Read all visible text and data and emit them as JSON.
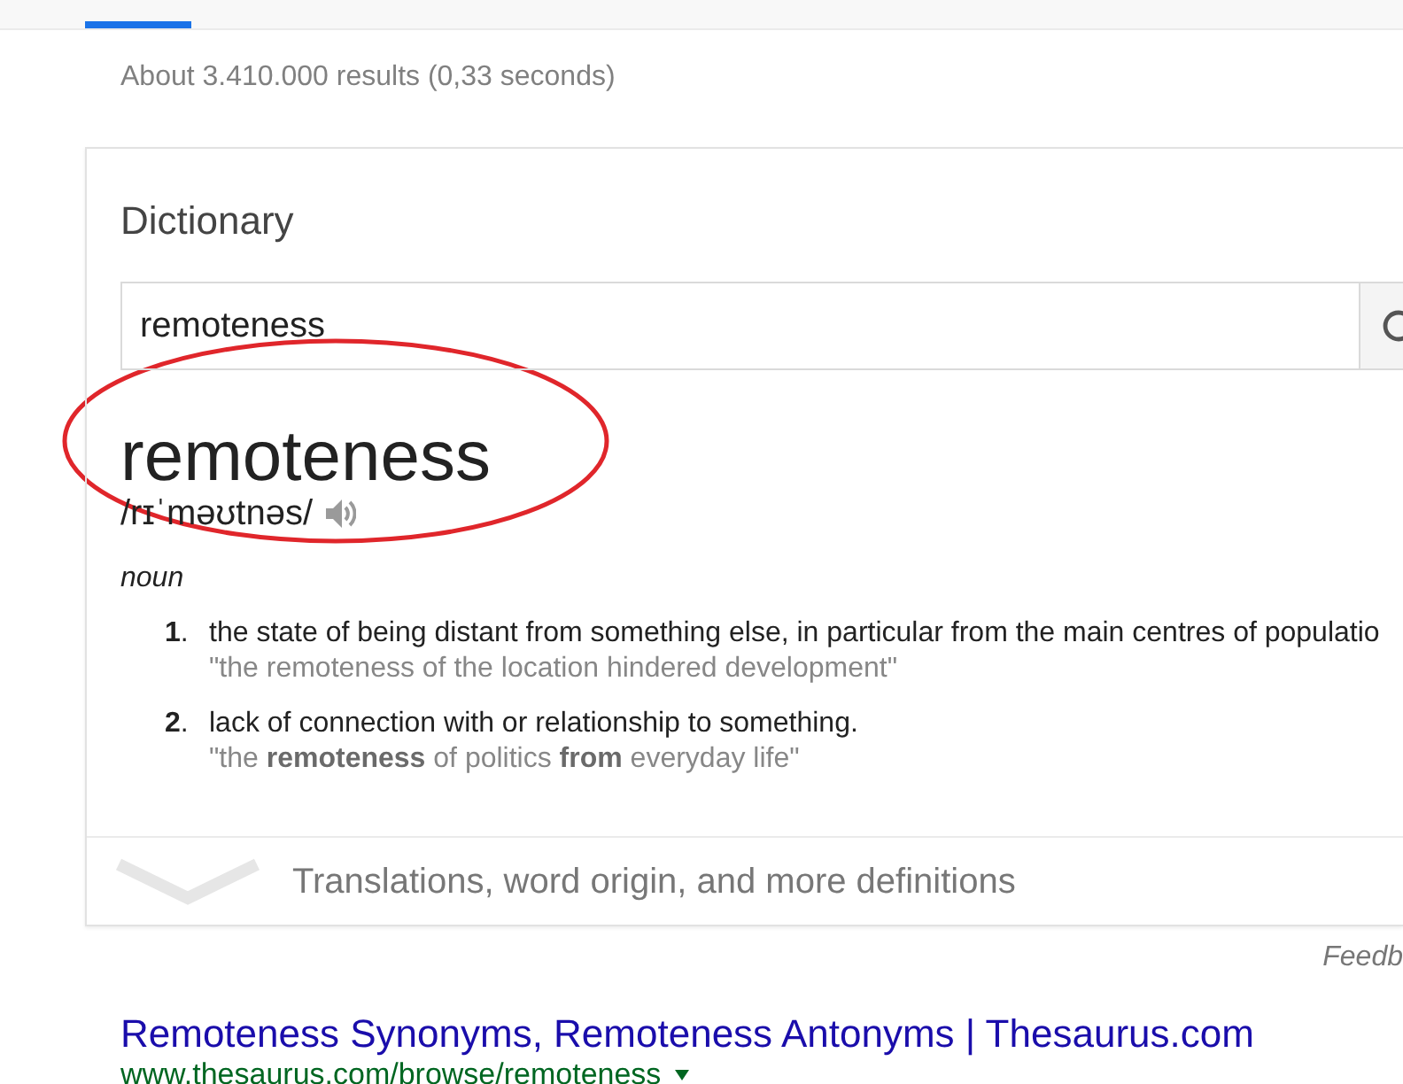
{
  "top_bar": {
    "tab_selected": true
  },
  "result_stats": "About 3.410.000 results (0,33 seconds)",
  "dictionary": {
    "title": "Dictionary",
    "search": {
      "value": "remoteness"
    },
    "headword": "remoteness",
    "pronunciation": "/rɪˈməʊtnəs/",
    "part_of_speech": "noun",
    "senses": [
      {
        "number": "**1**.",
        "text": "the state of being distant from something else, in particular from the main centres of populatio",
        "example": "\"the remoteness of the location hindered development\""
      },
      {
        "number": "**2**.",
        "text": "lack of connection with or relationship to something.",
        "example": "\"the **remoteness** of politics **from** everyday life\""
      }
    ],
    "more": "Translations, word origin, and more definitions"
  },
  "feedback": "Feedb",
  "results": [
    {
      "title": "Remoteness Synonyms, Remoteness Antonyms | Thesaurus.com",
      "url": "www.thesaurus.com/browse/remoteness"
    }
  ],
  "annotations": [
    {
      "kind": "ellipse"
    }
  ]
}
